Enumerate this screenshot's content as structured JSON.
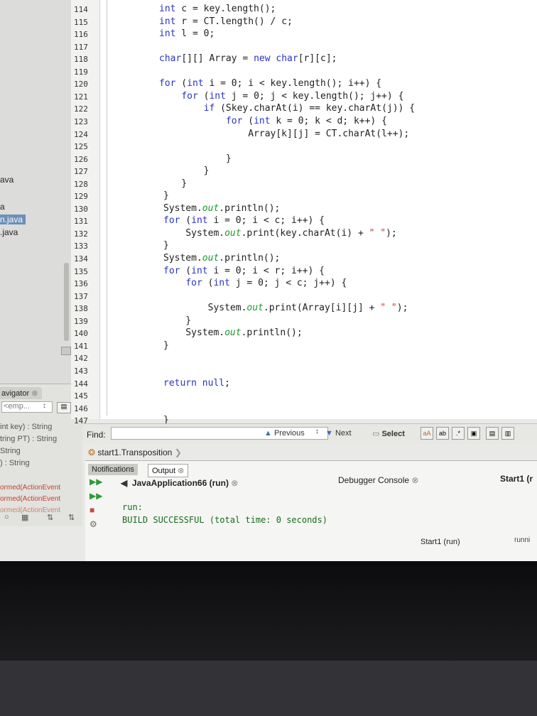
{
  "project": {
    "items": [
      "ava",
      "a",
      "n.java",
      ".java"
    ]
  },
  "navigator": {
    "tab_label": "avigator",
    "filter_value": "<emp...",
    "members": [
      "int key) : String",
      "tring PT) : String",
      "String",
      ") : String"
    ],
    "events": [
      "ormed(ActionEvent",
      "ormed(ActionEvent",
      "ormed(ActionEvent"
    ]
  },
  "editor": {
    "line_numbers": [
      "114",
      "115",
      "116",
      "117",
      "118",
      "119",
      "120",
      "121",
      "122",
      "123",
      "124",
      "125",
      "126",
      "127",
      "128",
      "129",
      "130",
      "131",
      "132",
      "133",
      "134",
      "135",
      "136",
      "137",
      "138",
      "139",
      "140",
      "141",
      "142",
      "143",
      "144",
      "145",
      "146",
      "147"
    ],
    "code": [
      "int c = key.length();",
      "int r = CT.length() / c;",
      "int l = 0;",
      "",
      "char[][] Array = new char[r][c];",
      "",
      "for (int i = 0; i < key.length(); i++) {",
      "    for (int j = 0; j < key.length(); j++) {",
      "        if (Skey.charAt(i) == key.charAt(j)) {",
      "            for (int k = 0; k < d; k++) {",
      "                Array[k][j] = CT.charAt(l++);",
      "",
      "            }",
      "        }",
      "    }",
      "}",
      "System.out.println();",
      "for (int i = 0; i < c; i++) {",
      "    System.out.print(key.charAt(i) + \" \");",
      "}",
      "System.out.println();",
      "for (int i = 0; i < r; i++) {",
      "    for (int j = 0; j < c; j++) {",
      "",
      "        System.out.print(Array[i][j] + \" \");",
      "    }",
      "    System.out.println();",
      "}",
      "",
      "",
      "return null;",
      "",
      "",
      "}"
    ]
  },
  "find_bar": {
    "label": "Find:",
    "value": "",
    "previous_label": "Previous",
    "next_label": "Next",
    "select_label": "Select"
  },
  "breadcrumb": "start1.Transposition",
  "output": {
    "notifications_tab": "Notifications",
    "output_tab": "Output",
    "run_tab": "JavaApplication66 (run)",
    "debugger_tab": "Debugger Console",
    "start1_tab": "Start1 (r",
    "lines": [
      "run:",
      "BUILD SUCCESSFUL (total time: 0 seconds)"
    ],
    "status_task": "Start1 (run)",
    "status_state": "runni"
  }
}
